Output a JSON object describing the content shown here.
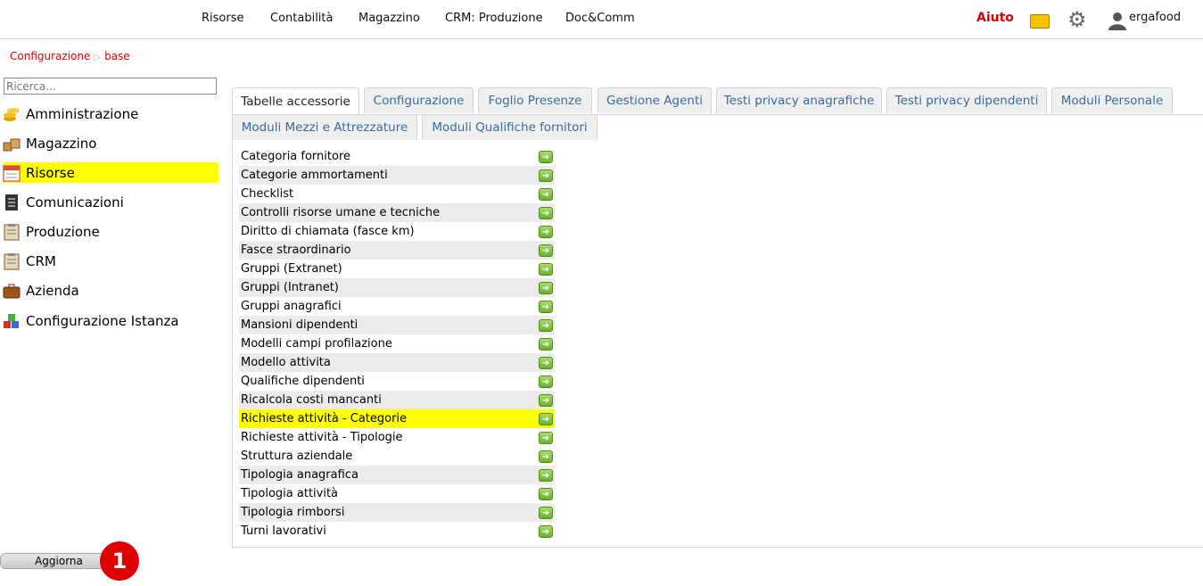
{
  "topnav": [
    "Risorse",
    "Contabilità",
    "Magazzino",
    "CRM: Produzione",
    "Doc&Comm"
  ],
  "help_label": "Aiuto",
  "user": "ergafood",
  "breadcrumb": [
    "Configurazione",
    "base"
  ],
  "search": {
    "placeholder": "Ricerca..."
  },
  "sidebar": {
    "items": [
      {
        "label": "Amministrazione",
        "icon": "coins-icon",
        "active": false
      },
      {
        "label": "Magazzino",
        "icon": "boxes-icon",
        "active": false
      },
      {
        "label": "Risorse",
        "icon": "calendar-icon",
        "active": true
      },
      {
        "label": "Comunicazioni",
        "icon": "document-icon",
        "active": false
      },
      {
        "label": "Produzione",
        "icon": "clipboard-icon",
        "active": false
      },
      {
        "label": "CRM",
        "icon": "clipboard-icon",
        "active": false
      },
      {
        "label": "Azienda",
        "icon": "briefcase-icon",
        "active": false
      },
      {
        "label": "Configurazione Istanza",
        "icon": "blocks-icon",
        "active": false
      }
    ]
  },
  "tabs": [
    "Tabelle accessorie",
    "Configurazione",
    "Foglio Presenze",
    "Gestione Agenti",
    "Testi privacy anagrafiche",
    "Testi privacy dipendenti",
    "Moduli Personale",
    "Moduli Mezzi e Attrezzature",
    "Moduli Qualifiche fornitori"
  ],
  "active_tab": "Tabelle accessorie",
  "rows": [
    "Categoria fornitore",
    "Categorie ammortamenti",
    "Checklist",
    "Controlli risorse umane e tecniche",
    "Diritto di chiamata (fasce km)",
    "Fasce straordinario",
    "Gruppi (Extranet)",
    "Gruppi (Intranet)",
    "Gruppi anagrafici",
    "Mansioni dipendenti",
    "Modelli campi profilazione",
    "Modello attivita",
    "Qualifiche dipendenti",
    "Ricalcola costi mancanti",
    "Richieste attività - Categorie",
    "Richieste attività - Tipologie",
    "Struttura aziendale",
    "Tipologia anagrafica",
    "Tipologia attività",
    "Tipologia rimborsi",
    "Turni lavorativi"
  ],
  "highlighted_row": "Richieste attività - Categorie",
  "refresh_label": "Aggiorna",
  "badge": "1",
  "colors": {
    "accent_red": "#e00000",
    "highlight": "#ffff00",
    "tab_text": "#3a6aa0"
  }
}
